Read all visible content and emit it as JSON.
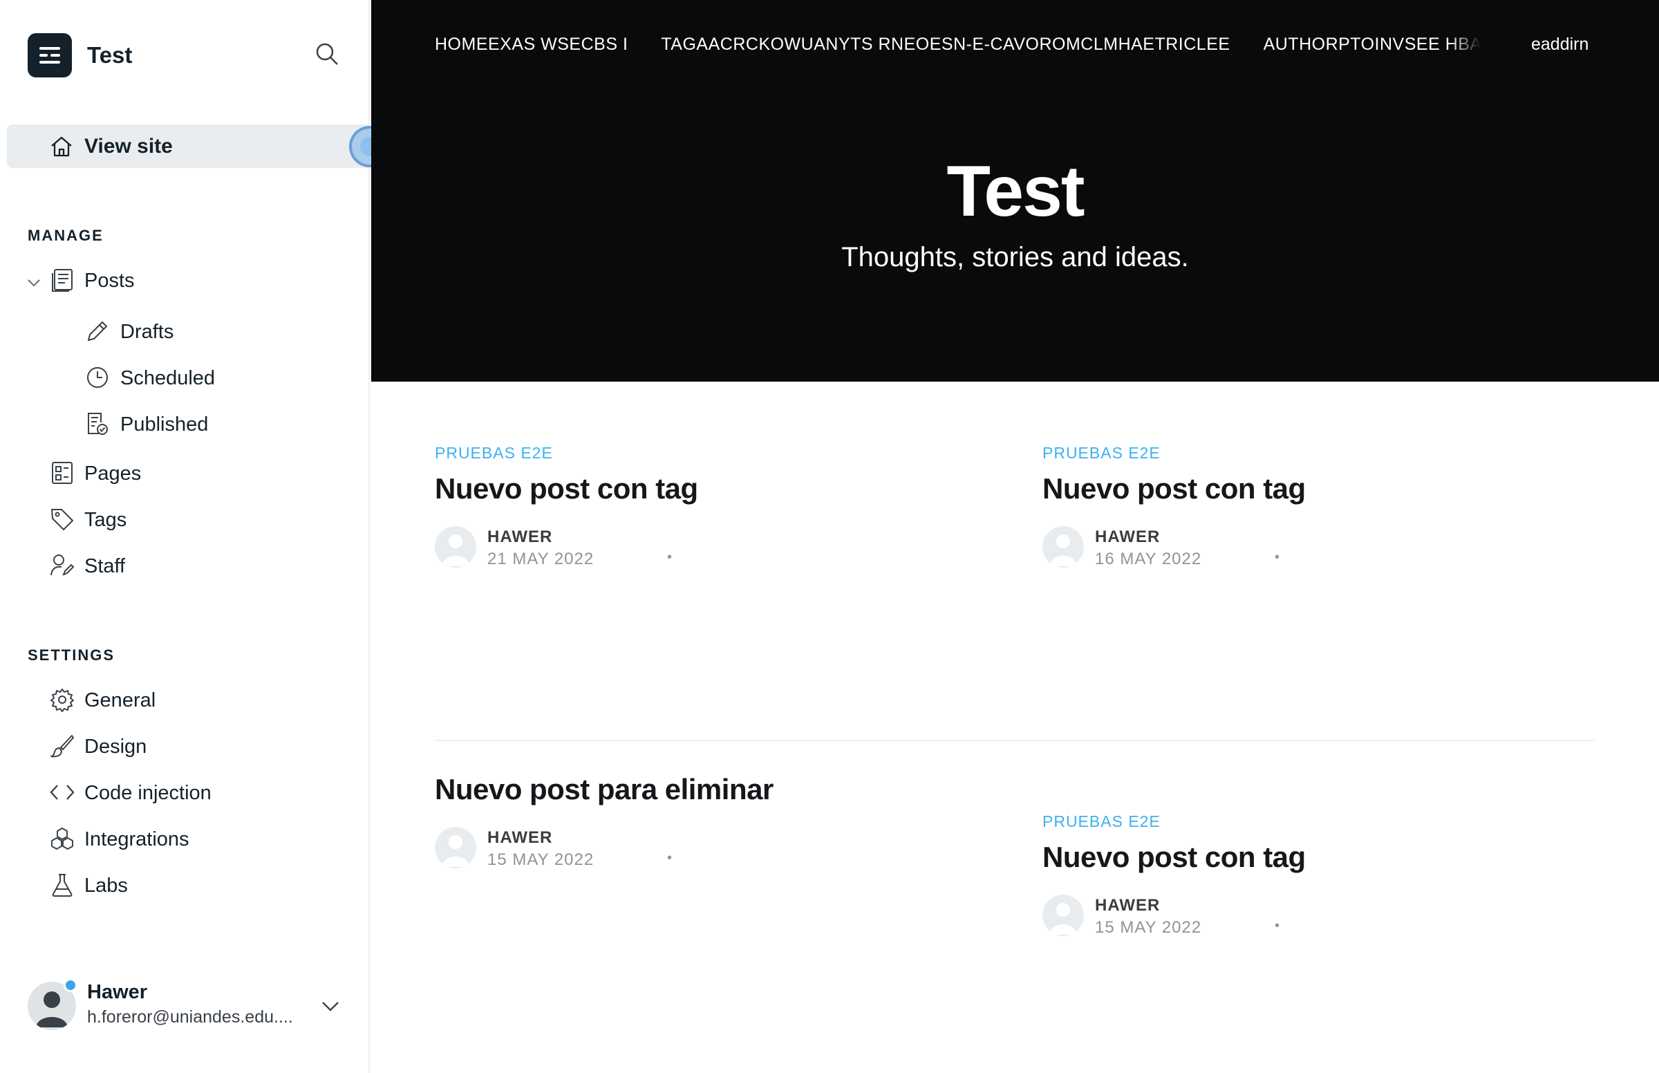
{
  "sidebar": {
    "brand_title": "Test",
    "view_site_label": "View site",
    "manage_label": "MANAGE",
    "manage_items": [
      {
        "label": "Posts"
      },
      {
        "label": "Drafts"
      },
      {
        "label": "Scheduled"
      },
      {
        "label": "Published"
      },
      {
        "label": "Pages"
      },
      {
        "label": "Tags"
      },
      {
        "label": "Staff"
      }
    ],
    "settings_label": "SETTINGS",
    "settings_items": [
      {
        "label": "General"
      },
      {
        "label": "Design"
      },
      {
        "label": "Code injection"
      },
      {
        "label": "Integrations"
      },
      {
        "label": "Labs"
      }
    ],
    "user": {
      "name": "Hawer",
      "email": "h.foreror@uniandes.edu...."
    }
  },
  "site": {
    "nav_links": [
      "HOMEEXAS WSECBS I",
      "TAGAACRCKOWUANYTS RNEOESN-E-CAVOROMCLMHAETRICLEE",
      "AUTHORPTOINVSEE HBAIS"
    ],
    "signin_label": "eaddirn",
    "title": "Test",
    "description": "Thoughts, stories and ideas.",
    "posts": [
      {
        "tag": "PRUEBAS E2E",
        "title": "Nuevo post con tag",
        "author": "HAWER",
        "date": "21 MAY 2022",
        "dot": "•"
      },
      {
        "tag": "PRUEBAS E2E",
        "title": "Nuevo post con tag",
        "author": "HAWER",
        "date": "16 MAY 2022",
        "dot": "•"
      },
      {
        "tag": "",
        "title": "Nuevo post para eliminar",
        "author": "HAWER",
        "date": "15 MAY 2022",
        "dot": "•"
      },
      {
        "tag": "PRUEBAS E2E",
        "title": "Nuevo post con tag",
        "author": "HAWER",
        "date": "15 MAY 2022",
        "dot": "•"
      }
    ]
  },
  "colors": {
    "accent": "#3eb0ef",
    "hero_bg": "#090a0b",
    "active_nav_bg": "#e9edf0",
    "status_dot": "#3fa4ea"
  }
}
